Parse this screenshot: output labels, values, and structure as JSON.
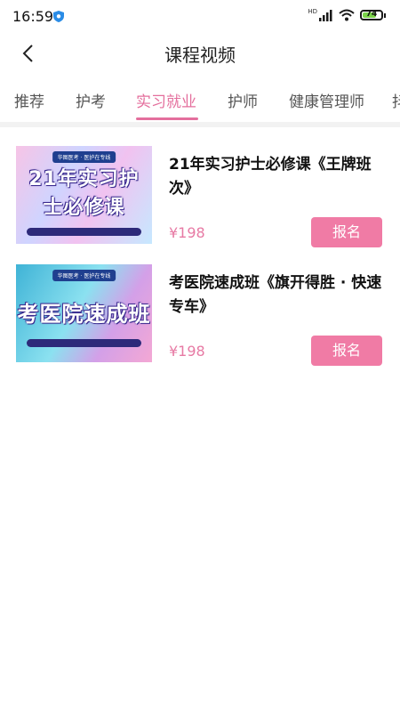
{
  "status_bar": {
    "time": "16:59",
    "battery_level": "74",
    "hd_label": "HD"
  },
  "header": {
    "title": "课程视频"
  },
  "tabs": [
    {
      "label": "推荐"
    },
    {
      "label": "护考"
    },
    {
      "label": "实习就业",
      "active": true
    },
    {
      "label": "护师"
    },
    {
      "label": "健康管理师"
    },
    {
      "label": "抖"
    }
  ],
  "courses": [
    {
      "title": "21年实习护士必修课《王牌班次》",
      "price": "¥198",
      "button": "报名",
      "thumb_text": "21年实习护士必修课",
      "thumb_brand": "华图医考 · 医护在专线"
    },
    {
      "title": "考医院速成班《旗开得胜 · 快速专车》",
      "price": "¥198",
      "button": "报名",
      "thumb_text": "考医院速成班",
      "thumb_brand": "华图医考 · 医护在专线"
    }
  ],
  "colors": {
    "accent": "#e46f9d",
    "button": "#f07ba5",
    "price": "#e77aa4"
  }
}
